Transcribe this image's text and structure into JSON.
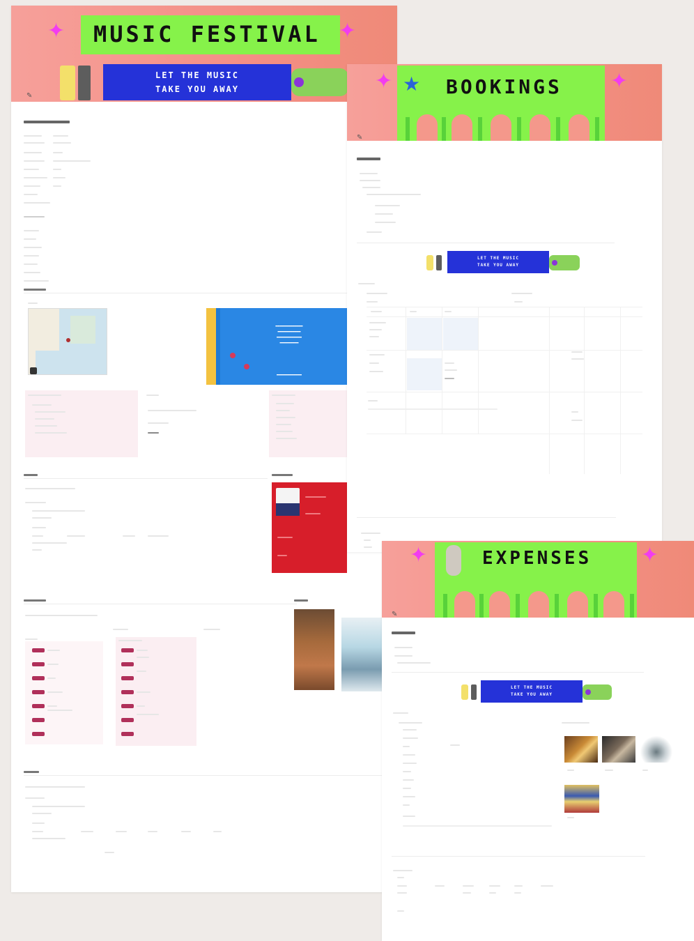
{
  "pages": {
    "festival": {
      "banner_title": "MUSIC FESTIVAL",
      "promo_line1": "LET THE MUSIC",
      "promo_line2": "TAKE YOU AWAY"
    },
    "bookings": {
      "banner_title": "BOOKINGS",
      "promo_line1": "LET THE MUSIC",
      "promo_line2": "TAKE YOU AWAY"
    },
    "expenses": {
      "banner_title": "EXPENSES",
      "promo_line1": "LET THE MUSIC",
      "promo_line2": "TAKE YOU AWAY"
    }
  },
  "colors": {
    "banner_pink": "#f6a09a",
    "banner_green": "#86f24a",
    "promo_blue": "#2532d8",
    "sparkle_magenta": "#f23cf0",
    "tag_red": "#b0305a",
    "card_red": "#d71e2a"
  },
  "icons": [
    "sparkle-icon",
    "rainbow-star-icon",
    "hand-icon",
    "page-icon"
  ]
}
